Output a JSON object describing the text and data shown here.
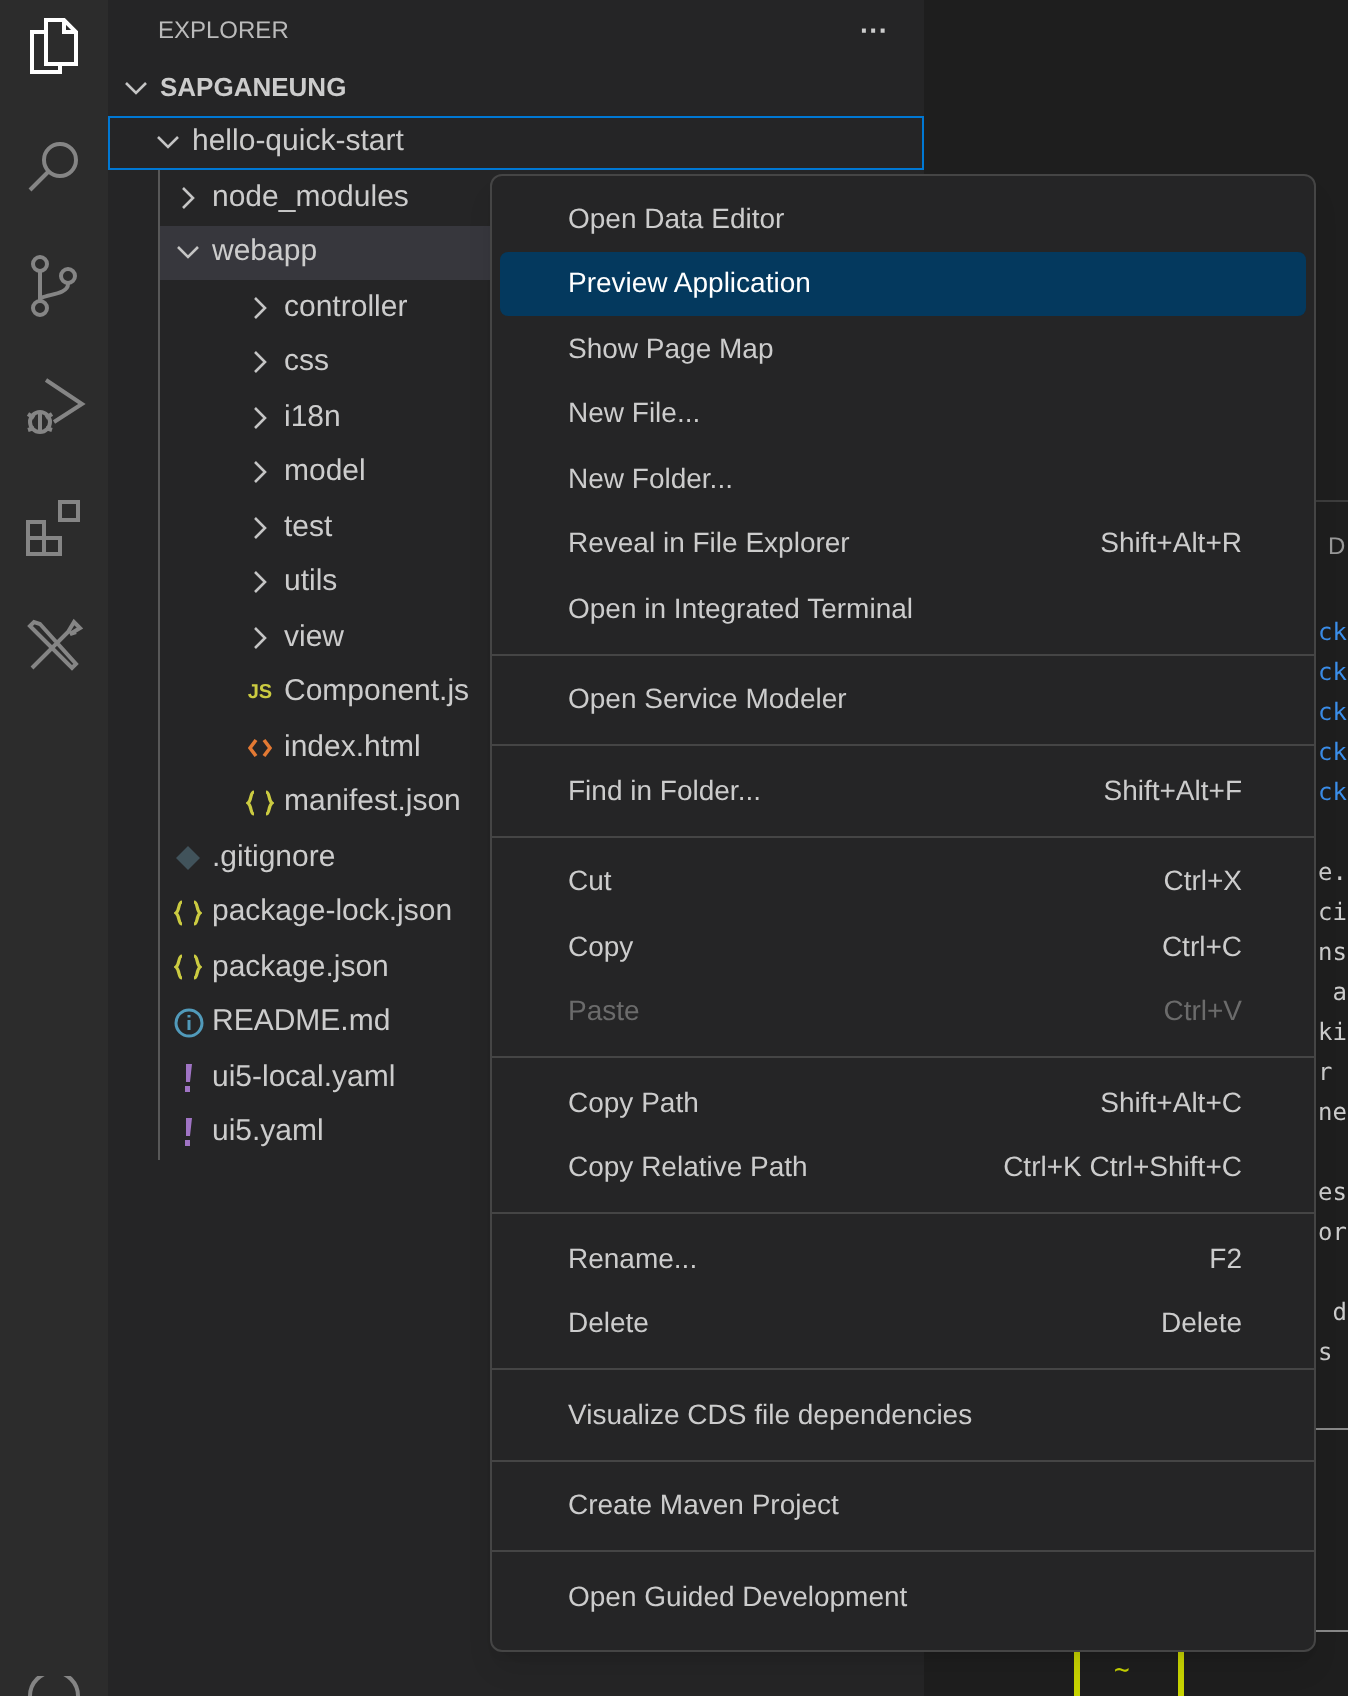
{
  "activity_bar": [
    {
      "kind": "files",
      "selected": true
    },
    {
      "kind": "search",
      "selected": false
    },
    {
      "kind": "source-control",
      "selected": false
    },
    {
      "kind": "run-debug",
      "selected": false
    },
    {
      "kind": "extensions",
      "selected": false
    },
    {
      "kind": "tools",
      "selected": false
    }
  ],
  "explorer": {
    "title": "EXPLORER",
    "more": "···",
    "tree": [
      {
        "label": "SAPGANEUNG",
        "kind": "root",
        "expanded": true,
        "children": [
          {
            "label": "hello-quick-start",
            "kind": "folder",
            "expanded": true,
            "focused": true,
            "selected": false,
            "children": [
              {
                "label": "node_modules",
                "kind": "folder",
                "expanded": false,
                "selected": false
              },
              {
                "label": "webapp",
                "kind": "folder",
                "expanded": true,
                "selected": true,
                "children": [
                  {
                    "label": "controller",
                    "kind": "folder",
                    "expanded": false,
                    "selected": false
                  },
                  {
                    "label": "css",
                    "kind": "folder",
                    "expanded": false,
                    "selected": false
                  },
                  {
                    "label": "i18n",
                    "kind": "folder",
                    "expanded": false,
                    "selected": false
                  },
                  {
                    "label": "model",
                    "kind": "folder",
                    "expanded": false,
                    "selected": false
                  },
                  {
                    "label": "test",
                    "kind": "folder",
                    "expanded": false,
                    "selected": false
                  },
                  {
                    "label": "utils",
                    "kind": "folder",
                    "expanded": false,
                    "selected": false
                  },
                  {
                    "label": "view",
                    "kind": "folder",
                    "expanded": false,
                    "selected": false
                  },
                  {
                    "label": "Component.js",
                    "kind": "js",
                    "icon_text": "JS",
                    "selected": false
                  },
                  {
                    "label": "index.html",
                    "kind": "html",
                    "selected": false
                  },
                  {
                    "label": "manifest.json",
                    "kind": "json",
                    "selected": false
                  }
                ]
              },
              {
                "label": ".gitignore",
                "kind": "git",
                "selected": false
              },
              {
                "label": "package-lock.json",
                "kind": "json",
                "selected": false
              },
              {
                "label": "package.json",
                "kind": "json",
                "selected": false
              },
              {
                "label": "README.md",
                "kind": "info",
                "selected": false
              },
              {
                "label": "ui5-local.yaml",
                "kind": "yaml",
                "selected": false
              },
              {
                "label": "ui5.yaml",
                "kind": "yaml",
                "selected": false
              }
            ]
          }
        ]
      }
    ]
  },
  "terminal": {
    "tab": "D",
    "lines": [
      {
        "text": "ck",
        "kind": "link"
      },
      {
        "text": "ck",
        "kind": "link"
      },
      {
        "text": "ck",
        "kind": "link"
      },
      {
        "text": "ck",
        "kind": "link"
      },
      {
        "text": "ck",
        "kind": "link"
      },
      {
        "kind": "blank"
      },
      {
        "text": "e.",
        "kind": "plain"
      },
      {
        "text": "ci",
        "kind": "plain"
      },
      {
        "text": "ns",
        "kind": "plain"
      },
      {
        "text": " a",
        "kind": "plain"
      },
      {
        "text": "ki",
        "kind": "plain"
      },
      {
        "text": "r",
        "kind": "plain"
      },
      {
        "text": "ne",
        "kind": "plain"
      },
      {
        "kind": "blank"
      },
      {
        "text": "es",
        "kind": "plain"
      },
      {
        "text": "or",
        "kind": "plain"
      },
      {
        "kind": "blank"
      },
      {
        "text": " d",
        "kind": "plain"
      },
      {
        "text": "s",
        "kind": "plain"
      }
    ],
    "prompt": "~"
  },
  "context_menu": {
    "groups": [
      [
        {
          "label": "Open Data Editor",
          "selected": false,
          "disabled": false
        },
        {
          "label": "Preview Application",
          "selected": true,
          "disabled": false
        },
        {
          "label": "Show Page Map",
          "selected": false,
          "disabled": false
        },
        {
          "label": "New File...",
          "selected": false,
          "disabled": false
        },
        {
          "label": "New Folder...",
          "selected": false,
          "disabled": false
        },
        {
          "label": "Reveal in File Explorer",
          "shortcut": "Shift+Alt+R",
          "selected": false,
          "disabled": false
        },
        {
          "label": "Open in Integrated Terminal",
          "selected": false,
          "disabled": false
        }
      ],
      [
        {
          "label": "Open Service Modeler",
          "selected": false,
          "disabled": false
        }
      ],
      [
        {
          "label": "Find in Folder...",
          "shortcut": "Shift+Alt+F",
          "selected": false,
          "disabled": false
        }
      ],
      [
        {
          "label": "Cut",
          "shortcut": "Ctrl+X",
          "selected": false,
          "disabled": false
        },
        {
          "label": "Copy",
          "shortcut": "Ctrl+C",
          "selected": false,
          "disabled": false
        },
        {
          "label": "Paste",
          "shortcut": "Ctrl+V",
          "selected": false,
          "disabled": true
        }
      ],
      [
        {
          "label": "Copy Path",
          "shortcut": "Shift+Alt+C",
          "selected": false,
          "disabled": false
        },
        {
          "label": "Copy Relative Path",
          "shortcut": "Ctrl+K Ctrl+Shift+C",
          "selected": false,
          "disabled": false
        }
      ],
      [
        {
          "label": "Rename...",
          "shortcut": "F2",
          "selected": false,
          "disabled": false
        },
        {
          "label": "Delete",
          "shortcut": "Delete",
          "selected": false,
          "disabled": false
        }
      ],
      [
        {
          "label": "Visualize CDS file dependencies",
          "selected": false,
          "disabled": false
        }
      ],
      [
        {
          "label": "Create Maven Project",
          "selected": false,
          "disabled": false
        }
      ],
      [
        {
          "label": "Open Guided Development",
          "selected": false,
          "disabled": false
        }
      ]
    ]
  }
}
